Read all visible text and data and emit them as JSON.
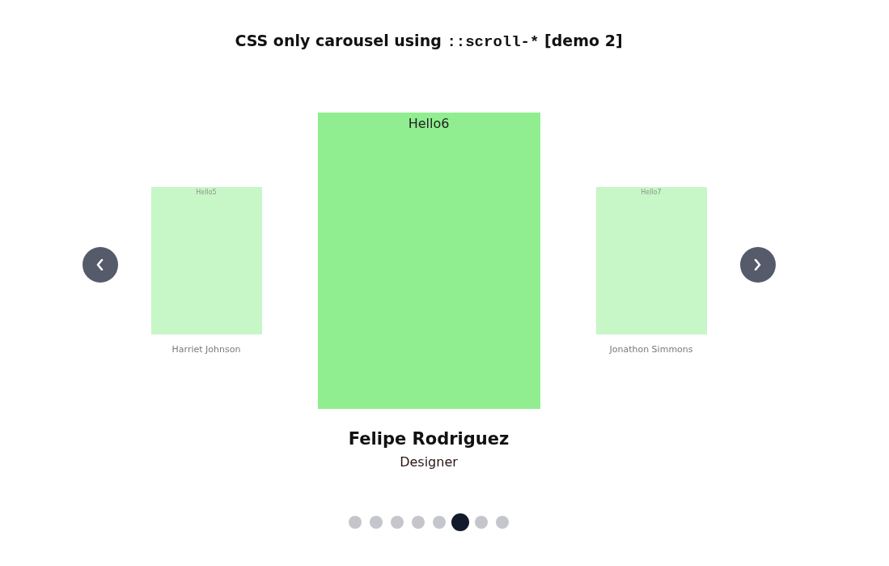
{
  "title": {
    "text": "CSS only carousel using",
    "code": "::scroll-*",
    "suffix": "[demo 2]"
  },
  "slides": [
    {
      "label": "Hello5",
      "name": "Harriet Johnson",
      "selected": false
    },
    {
      "label": "Hello6",
      "name": "Felipe Rodriguez",
      "role": "Designer",
      "selected": true
    },
    {
      "label": "Hello7",
      "name": "Jonathon Simmons",
      "selected": false
    }
  ],
  "dots": [
    {
      "selected": false
    },
    {
      "selected": false
    },
    {
      "selected": false
    },
    {
      "selected": false
    },
    {
      "selected": false
    },
    {
      "selected": true
    },
    {
      "selected": false
    },
    {
      "selected": false
    }
  ]
}
